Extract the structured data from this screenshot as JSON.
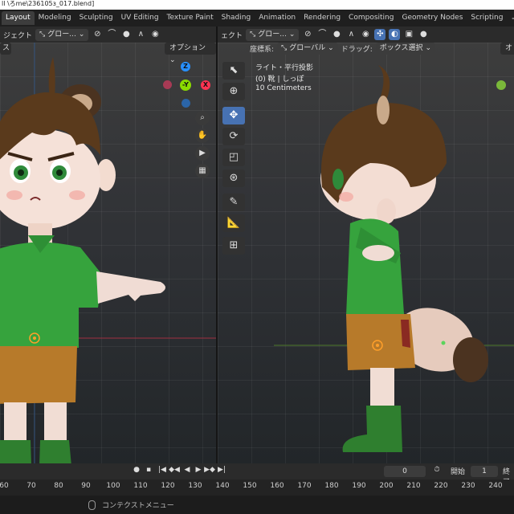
{
  "window": {
    "title": "ll \\ろme\\236105з_017.blend]"
  },
  "workspaces": {
    "tabs": [
      "Layout",
      "Modeling",
      "Sculpting",
      "UV Editing",
      "Texture Paint",
      "Shading",
      "Animation",
      "Rendering",
      "Compositing",
      "Geometry Nodes",
      "Scripting"
    ],
    "active": "Layout",
    "add": "+"
  },
  "left_viewport": {
    "header": {
      "mode_label": "ジェクト",
      "orientation": "グロー..."
    },
    "options_label": "オプション",
    "view_menu": "ス"
  },
  "right_viewport": {
    "header": {
      "mode_label": "ェクト",
      "orientation": "グロー...",
      "coords_label": "座標系:",
      "coords_value": "グローバル",
      "drag_label": "ドラッグ:",
      "drag_value": "ボックス選択"
    },
    "options_label": "オ",
    "info": {
      "view_name": "ライト・平行投影",
      "object": "(0) 靴 | しっぽ",
      "scale": "10 Centimeters"
    }
  },
  "gizmo": {
    "z": "Z",
    "y": "-Y",
    "x": "X"
  },
  "timeline": {
    "current_frame": "0",
    "start_label": "開始",
    "start_value": "1",
    "end_label": "終了",
    "ruler": [
      "60",
      "70",
      "80",
      "90",
      "100",
      "110",
      "120",
      "130",
      "140",
      "150",
      "160",
      "170",
      "180",
      "190",
      "200",
      "210",
      "220",
      "230",
      "240"
    ]
  },
  "statusbar": {
    "context_menu": "コンテクストメニュー"
  },
  "colors": {
    "accent": "#4772b3",
    "axis_x": "#ff3352",
    "axis_y": "#8bdc00",
    "axis_z": "#2890ff"
  }
}
